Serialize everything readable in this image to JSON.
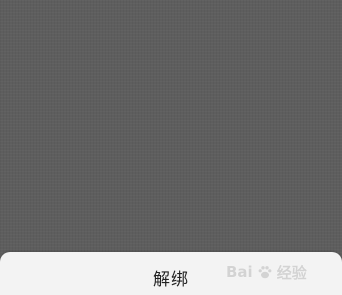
{
  "dim_overlay": {
    "color": "#5e5e5e"
  },
  "action_sheet": {
    "unbind_label": "解绑",
    "background": "#f3f3f3"
  },
  "watermark": {
    "brand_left": "Bai",
    "brand_right": "经验",
    "icon": "paw-logo-icon"
  }
}
